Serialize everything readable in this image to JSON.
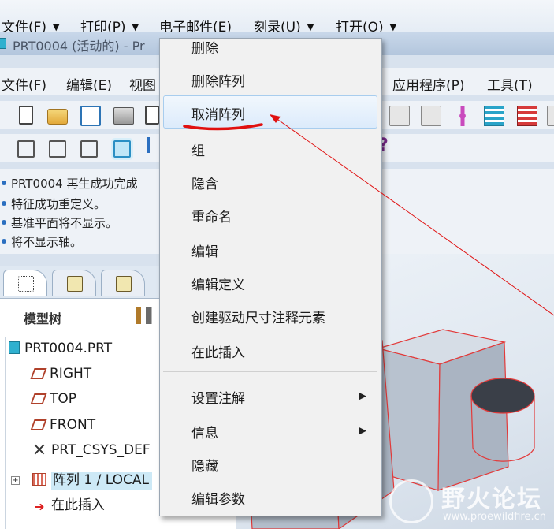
{
  "explorer_bar": {
    "items": [
      {
        "label": "文件(F)"
      },
      {
        "label": "打印(P)"
      },
      {
        "label": "电子邮件(E)"
      },
      {
        "label": "刻录(U)"
      },
      {
        "label": "打开(O)"
      }
    ]
  },
  "window": {
    "title": "PRT0004 (活动的) - Pr"
  },
  "menubar": {
    "items": [
      {
        "label": "文件(F)"
      },
      {
        "label": "编辑(E)"
      },
      {
        "label": "视图"
      },
      {
        "label": "应用程序(P)"
      },
      {
        "label": "工具(T)"
      }
    ]
  },
  "toolbar": {
    "help_glyph": "?"
  },
  "messages": [
    "PRT0004 再生成功完成",
    "特征成功重定义。",
    "基准平面将不显示。",
    "将不显示轴。"
  ],
  "model_tree": {
    "header": "模型树",
    "rows": [
      {
        "label": "PRT0004.PRT",
        "icon": "part-icon"
      },
      {
        "label": "RIGHT",
        "icon": "datum-plane-icon"
      },
      {
        "label": "TOP",
        "icon": "datum-plane-icon"
      },
      {
        "label": "FRONT",
        "icon": "datum-plane-icon"
      },
      {
        "label": "PRT_CSYS_DEF",
        "icon": "csys-icon"
      },
      {
        "label": "阵列 1 / LOCAL",
        "icon": "pattern-icon"
      },
      {
        "label": "在此插入",
        "icon": "insert-arrow-icon"
      }
    ],
    "expander_glyph": "+",
    "insert_glyph": "➜"
  },
  "context_menu": {
    "items": [
      {
        "label": "删除"
      },
      {
        "label": "删除阵列"
      },
      {
        "label": "取消阵列"
      },
      {
        "label": "组"
      },
      {
        "label": "隐含"
      },
      {
        "label": "重命名"
      },
      {
        "label": "编辑"
      },
      {
        "label": "编辑定义"
      },
      {
        "label": "创建驱动尺寸注释元素"
      },
      {
        "label": "在此插入"
      },
      {
        "label": "设置注解"
      },
      {
        "label": "信息"
      },
      {
        "label": "隐藏"
      },
      {
        "label": "编辑参数"
      }
    ],
    "submenu_glyph": "▶"
  },
  "watermark": {
    "text": "野火论坛",
    "url": "www.proewildfire.cn"
  },
  "colors": {
    "annotation_red": "#e01010",
    "accent_blue": "#2a8fc4"
  }
}
